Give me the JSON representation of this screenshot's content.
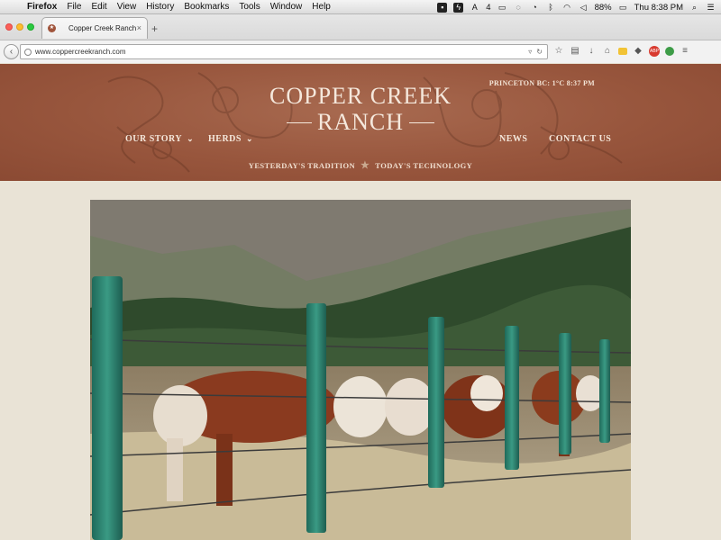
{
  "menubar": {
    "app_name": "Firefox",
    "items": [
      "File",
      "Edit",
      "View",
      "History",
      "Bookmarks",
      "Tools",
      "Window",
      "Help"
    ],
    "battery": "88%",
    "clock": "Thu 8:38 PM",
    "badge_count": "4"
  },
  "browser": {
    "tab_title": "Copper Creek Ranch",
    "tab_close": "×",
    "new_tab": "+",
    "url": "www.coppercreekranch.com"
  },
  "site": {
    "weather": "PRINCETON BC:  1°C  8:37 PM",
    "logo_line1": "COPPER CREEK",
    "logo_line2": "RANCH",
    "nav": {
      "our_story": "OUR STORY",
      "herds": "HERDS",
      "news": "NEWS",
      "contact": "CONTACT US"
    },
    "tagline_left": "YESTERDAY'S TRADITION",
    "tagline_right": "TODAY'S TECHNOLOGY",
    "colors": {
      "header_brown": "#98563d",
      "page_bg": "#e9e3d6",
      "logo_cream": "#f5e8dc"
    }
  }
}
